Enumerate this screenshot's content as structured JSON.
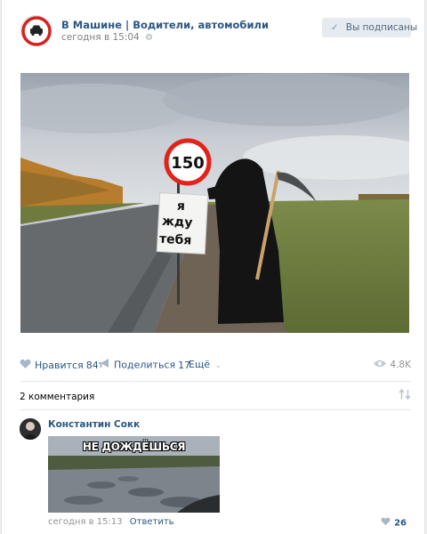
{
  "post": {
    "group_name": "В Машине | Водители, автомобили",
    "date": "сегодня в 15:04",
    "subscribed_label": "Вы подписаны"
  },
  "photo": {
    "sign_speed": "150",
    "sign_text_line1": "я",
    "sign_text_line2": "жду",
    "sign_text_line3": "тебя"
  },
  "actions": {
    "like_label": "Нравится",
    "like_count": "84",
    "share_label": "Поделиться",
    "share_count": "17",
    "more_label": "Ещё",
    "views": "4.8K"
  },
  "comments": {
    "count_label": "2 комментария",
    "items": [
      {
        "author": "Константин Сокк",
        "image_text": "НЕ ДОЖДЁШЬСЯ",
        "date": "сегодня в 15:13",
        "reply_label": "Ответить",
        "likes": "26"
      }
    ]
  },
  "colors": {
    "link": "#2a5885",
    "muted": "#939393",
    "button_bg": "#e5ebf1",
    "sign_red": "#e2231a"
  },
  "icons": {
    "group_avatar": "no-car-sign-icon",
    "settings": "gear-icon",
    "subscribed": "check-icon",
    "like": "heart-icon",
    "share": "megaphone-icon",
    "more": "chevron-down-icon",
    "views": "eye-icon",
    "sort": "sort-arrows-icon"
  }
}
